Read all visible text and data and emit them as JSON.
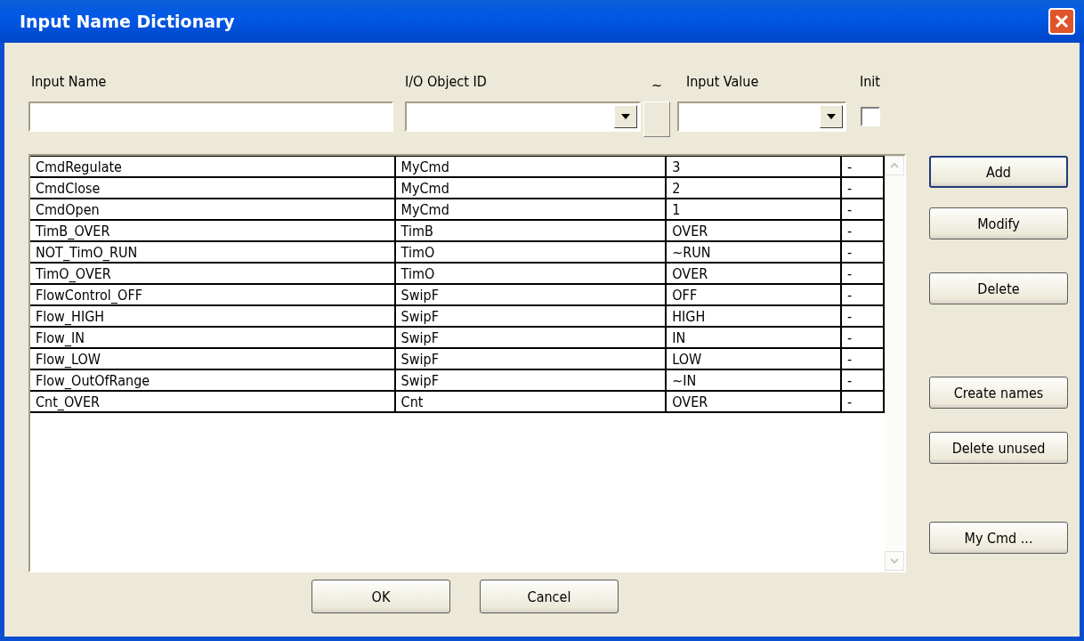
{
  "window": {
    "title": "Input Name Dictionary"
  },
  "fields": {
    "input_name": {
      "label": "Input Name"
    },
    "io_object_id": {
      "label": "I/O Object ID"
    },
    "tilde_button": {
      "label": "~"
    },
    "input_value": {
      "label": "Input Value"
    },
    "init": {
      "label": "Init",
      "checked": false
    }
  },
  "table": {
    "rows": [
      {
        "cells": [
          "CmdRegulate",
          "MyCmd",
          "3",
          "-"
        ]
      },
      {
        "cells": [
          "CmdClose",
          "MyCmd",
          "2",
          "-"
        ]
      },
      {
        "cells": [
          "CmdOpen",
          "MyCmd",
          "1",
          "-"
        ]
      },
      {
        "cells": [
          "TimB_OVER",
          "TimB",
          "OVER",
          "-"
        ]
      },
      {
        "cells": [
          "NOT_TimO_RUN",
          "TimO",
          "~RUN",
          "-"
        ]
      },
      {
        "cells": [
          "TimO_OVER",
          "TimO",
          "OVER",
          "-"
        ]
      },
      {
        "cells": [
          "FlowControl_OFF",
          "SwipF",
          "OFF",
          "-"
        ]
      },
      {
        "cells": [
          "Flow_HIGH",
          "SwipF",
          "HIGH",
          "-"
        ]
      },
      {
        "cells": [
          "Flow_IN",
          "SwipF",
          "IN",
          "-"
        ]
      },
      {
        "cells": [
          "Flow_LOW",
          "SwipF",
          "LOW",
          "-"
        ]
      },
      {
        "cells": [
          "Flow_OutOfRange",
          "SwipF",
          "~IN",
          "-"
        ]
      },
      {
        "cells": [
          "Cnt_OVER",
          "Cnt",
          "OVER",
          "-"
        ]
      }
    ]
  },
  "side_buttons": [
    {
      "label": "Add",
      "default": true
    },
    {
      "label": "Modify",
      "default": false
    },
    {
      "label": "Delete",
      "default": false
    },
    {
      "label": "Create names",
      "default": false
    },
    {
      "label": "Delete unused",
      "default": false
    },
    {
      "label": "My Cmd ...",
      "default": false
    }
  ],
  "bottom_buttons": [
    {
      "label": "OK"
    },
    {
      "label": "Cancel"
    }
  ]
}
